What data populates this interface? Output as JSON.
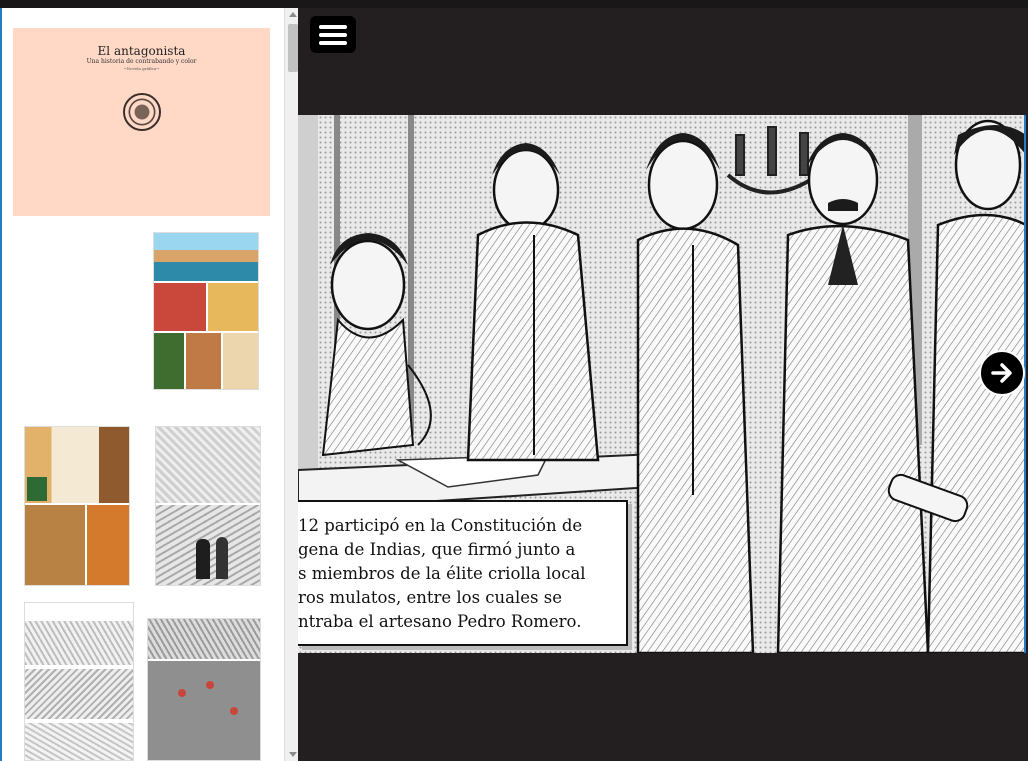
{
  "colors": {
    "viewer_background": "#231f20",
    "cover_background": "#ffd8c6",
    "sidebar_background": "#ffffff",
    "accent_border": "#2a7cc0"
  },
  "sidebar": {
    "cover": {
      "title": "El antagonista",
      "subtitle": "Una historia de contrabando y color",
      "tag": "~Novela gráfica~"
    },
    "thumbnails": [
      {
        "page": 1,
        "style": "color"
      },
      {
        "page": 2,
        "style": "color"
      },
      {
        "page": 3,
        "style": "bw"
      },
      {
        "page": 4,
        "style": "bw"
      },
      {
        "page": 5,
        "style": "bw-with-map"
      }
    ]
  },
  "toolbar": {
    "menu_icon": "hamburger-menu-icon"
  },
  "viewer": {
    "caption_lines": [
      "12 participó en la Constitución de",
      "gena de Indias, que firmó junto a",
      "s miembros de la élite criolla local",
      "ros mulatos, entre los cuales se",
      "ntraba el artesano Pedro Romero."
    ],
    "next_icon": "arrow-right-icon"
  }
}
